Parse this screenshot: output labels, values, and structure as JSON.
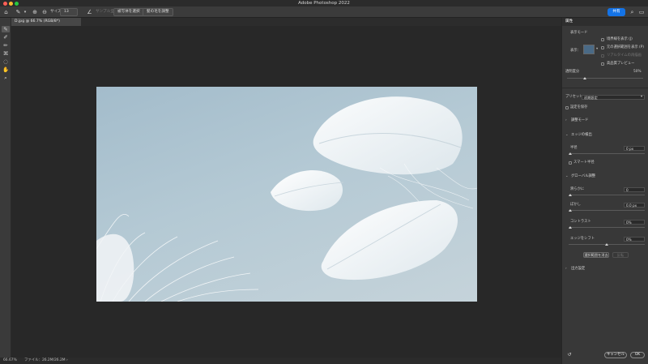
{
  "app": {
    "title": "Adobe Photoshop 2022"
  },
  "options_bar": {
    "size_label": "サイズ：",
    "size_value": "13",
    "disabled_label": "サンプル全レイヤー",
    "subject_button": "被写体を選択",
    "hair_button": "髪の毛を調整",
    "share_label": "共有"
  },
  "document": {
    "tab_label": "D.jpg @ 66.7% (RGB/8*)"
  },
  "status": {
    "zoom": "66.67%",
    "file_info": "ファイル：26.2M/26.2M"
  },
  "panel": {
    "title": "属性",
    "view_mode_heading": "表示モード",
    "view_label": "表示：",
    "show_edges": "境界線を表示 (J)",
    "show_original": "元の選択範囲を表示 (P)",
    "realtime": "リアルタイムの再描画",
    "hq_preview": "高品質プレビュー",
    "opacity_label": "透明度分",
    "opacity_value": "50%",
    "preset_label": "プリセット：",
    "preset_value": "初期設定",
    "remember_settings": "設定を保存",
    "adjust_mode": "調整モード",
    "edge_detection": "エッジの検出",
    "radius_label": "半径",
    "radius_value": "0 px",
    "smart_radius": "スマート半径",
    "global_refine": "グローバル調整",
    "smooth_label": "滑らかに",
    "smooth_value": "0",
    "feather_label": "ぼかし",
    "feather_value": "0.0 px",
    "contrast_label": "コントラスト",
    "contrast_value": "0%",
    "shift_edge_label": "エッジをシフト",
    "shift_edge_value": "0%",
    "clear_selection": "選択範囲を消去",
    "invert": "反転",
    "output_settings": "出力設定",
    "cancel": "キャンセル",
    "ok": "OK"
  },
  "colors": {
    "accent": "#1473e6",
    "canvas_bg": "#282828",
    "panel_bg": "#383838"
  }
}
